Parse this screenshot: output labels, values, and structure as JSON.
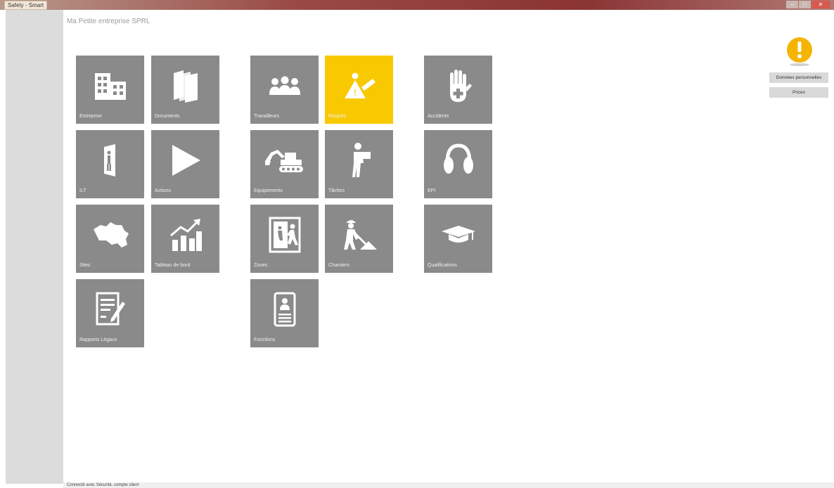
{
  "window": {
    "title": "Safety - Smart",
    "controls": {
      "minimize": "–",
      "maximize": "□",
      "close": "✕"
    }
  },
  "company_name": "Ma Petite entreprise SPRL",
  "tiles": [
    {
      "label": "Entreprise",
      "icon": "building-icon"
    },
    {
      "label": "Documents",
      "icon": "books-icon"
    },
    {
      "label": "Travailleurs",
      "icon": "workers-icon"
    },
    {
      "label": "Risques",
      "icon": "risk-sign-icon",
      "active": true
    },
    {
      "label": "Accidents",
      "icon": "hand-cross-icon"
    },
    {
      "label": "ILT",
      "icon": "door-person-icon"
    },
    {
      "label": "Actions",
      "icon": "play-icon"
    },
    {
      "label": "Equipements",
      "icon": "excavator-icon"
    },
    {
      "label": "Tâches",
      "icon": "worker-box-icon"
    },
    {
      "label": "EPI",
      "icon": "ear-protection-icon"
    },
    {
      "label": "Sites",
      "icon": "map-icon"
    },
    {
      "label": "Tableau de bord",
      "icon": "chart-icon"
    },
    {
      "label": "Zones",
      "icon": "exit-sign-icon"
    },
    {
      "label": "Chantiers",
      "icon": "digger-worker-icon"
    },
    {
      "label": "Qualifications",
      "icon": "graduation-cap-icon"
    },
    {
      "label": "Rapports Légaux",
      "icon": "report-icon"
    },
    {
      "label": "Fonctions",
      "icon": "id-badge-icon"
    }
  ],
  "right_panel": {
    "warning_icon": "warning-icon",
    "warning_color": "#f5b400",
    "personal_data_button": "Données personnelles",
    "prices_button": "Prices"
  },
  "status_bar": {
    "text": "Connecté avec Sécurité, compte client"
  },
  "colors": {
    "tile": "#8a8a8a",
    "tile_active": "#f8c800",
    "sidebar": "#dcdcdc"
  }
}
